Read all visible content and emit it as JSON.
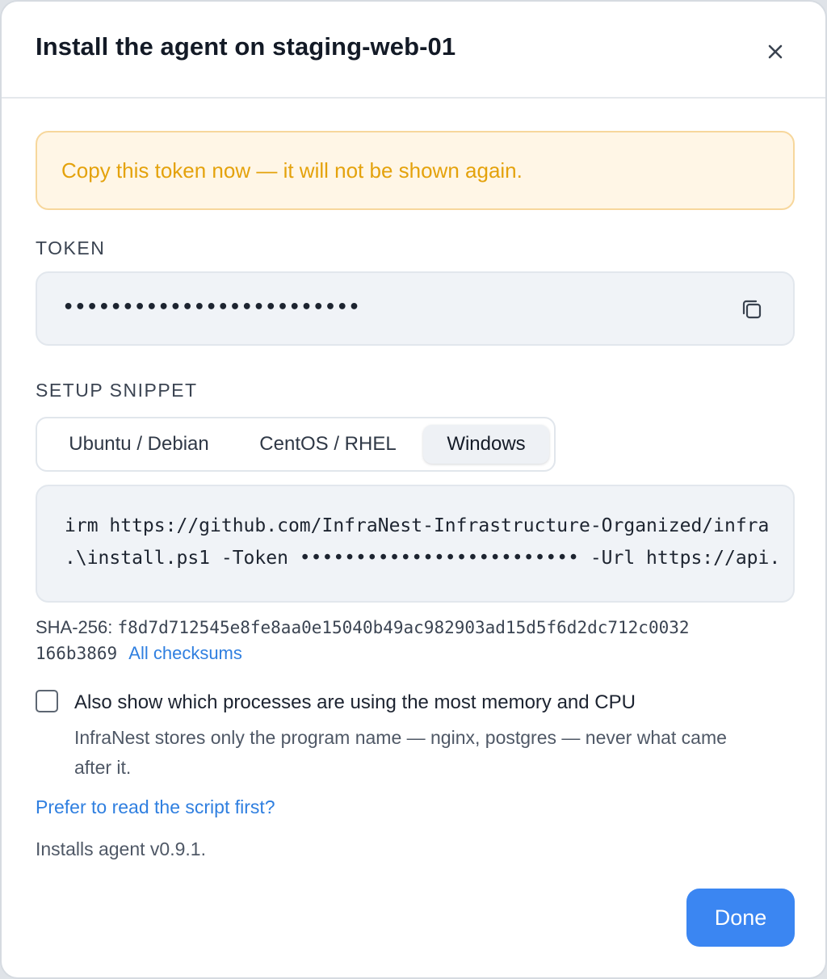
{
  "modal": {
    "title": "Install the agent on staging-web-01",
    "close_icon": "close-icon"
  },
  "alert": {
    "text": "Copy this token now — it will not be shown again.",
    "background_color": "#fff6e6",
    "text_color": "#e4a20c"
  },
  "token": {
    "label": "TOKEN",
    "value": "•••••••••••••••••••••••••",
    "copy_icon": "copy-icon"
  },
  "snippet": {
    "label": "SETUP SNIPPET",
    "tabs": [
      {
        "label": "Ubuntu / Debian",
        "active": false
      },
      {
        "label": "CentOS / RHEL",
        "active": false
      },
      {
        "label": "Windows",
        "active": true
      }
    ],
    "code_lines": [
      "irm https://github.com/InfraNest-Infrastructure-Organized/infra",
      ".\\install.ps1 -Token ••••••••••••••••••••••••• -Url https://api."
    ]
  },
  "checksum": {
    "label": "SHA-256:",
    "hash_part1": "f8d7d712545e8fe8aa0e15040b49ac982903ad15d5f6d2dc712c0032",
    "hash_part2": "166b3869",
    "link": "All checksums"
  },
  "option": {
    "checked": false,
    "label": "Also show which processes are using the most memory and CPU",
    "description": "InfraNest stores only the program name — nginx, postgres — never what came after it."
  },
  "read_script_link": "Prefer to read the script first?",
  "version_note": "Installs agent v0.9.1.",
  "done_button": "Done",
  "colors": {
    "accent": "#3b86f2",
    "link": "#2f7fe0"
  }
}
